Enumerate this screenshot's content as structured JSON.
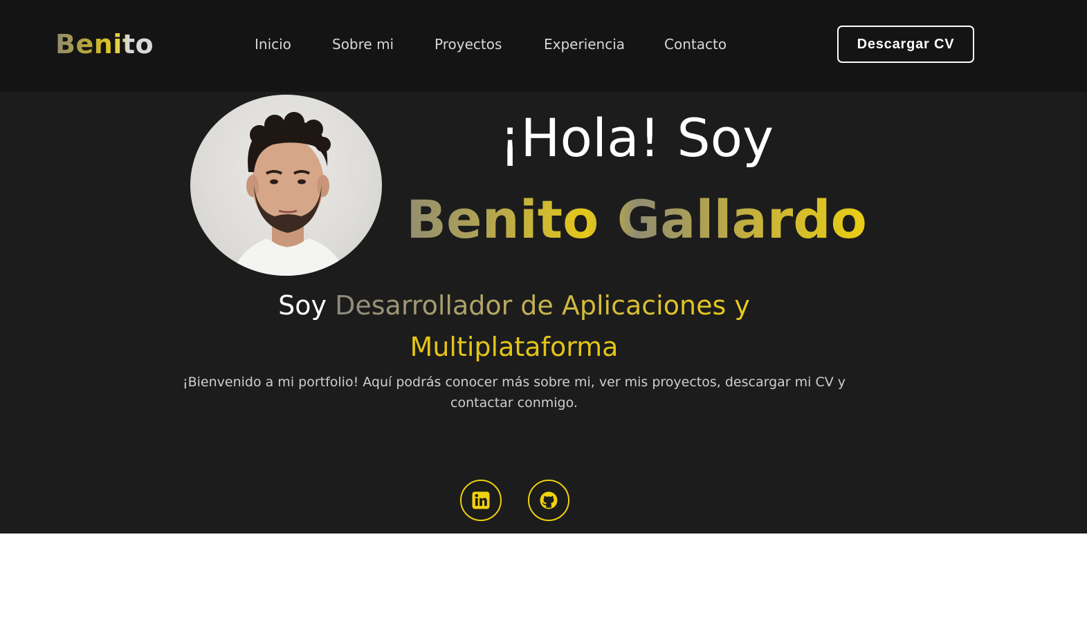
{
  "brand": {
    "logo_text": "Benito"
  },
  "nav": {
    "items": [
      {
        "label": "Inicio"
      },
      {
        "label": "Sobre mi"
      },
      {
        "label": "Proyectos"
      },
      {
        "label": "Experiencia"
      },
      {
        "label": "Contacto"
      }
    ],
    "cta_label": "Descargar CV"
  },
  "hero": {
    "greeting": "¡Hola! Soy",
    "name": "Benito Gallardo",
    "role_prefix": "Soy",
    "role_line1": "Desarrollador de Aplicaciones y",
    "role_line2": "Multiplataforma",
    "welcome": "¡Bienvenido a mi portfolio! Aquí podrás conocer más sobre mi, ver mis proyectos, descargar mi CV y contactar conmigo.",
    "avatar_icon": "profile-photo",
    "socials": [
      {
        "icon": "linkedin-icon"
      },
      {
        "icon": "github-icon"
      }
    ]
  },
  "colors": {
    "navbar_bg": "#141414",
    "hero_bg": "#1c1c1c",
    "accent_yellow": "#f0d10e",
    "muted_gray": "#8c8a80"
  }
}
